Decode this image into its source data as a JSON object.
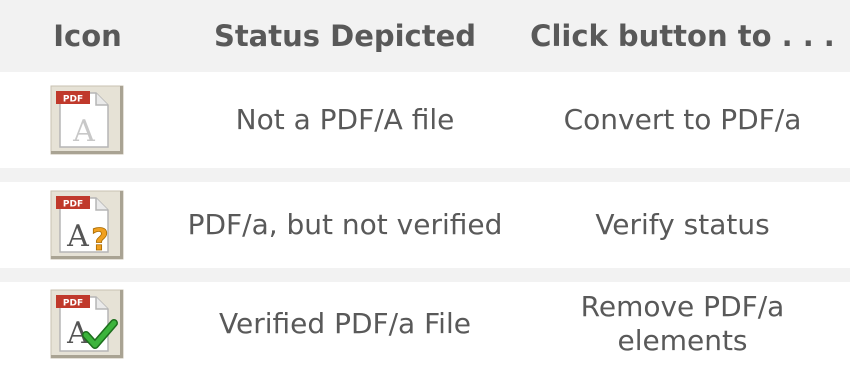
{
  "header": {
    "col_icon": "Icon",
    "col_status": "Status Depicted",
    "col_action": "Click button to . . ."
  },
  "rows": [
    {
      "icon": "pdf-a-not-pdfa-icon",
      "status": "Not a PDF/A file",
      "action": "Convert to PDF/a"
    },
    {
      "icon": "pdf-a-unverified-icon",
      "status": "PDF/a, but not verified",
      "action": "Verify status"
    },
    {
      "icon": "pdf-a-verified-icon",
      "status": "Verified PDF/a File",
      "action": "Remove PDF/a elements"
    }
  ],
  "icon_text": {
    "badge": "PDF",
    "letter": "A",
    "question": "?"
  },
  "colors": {
    "header_bg": "#f2f2f2",
    "text": "#595959",
    "badge_red": "#c0392b",
    "question_orange": "#f0a020",
    "check_green": "#2e9e2e"
  }
}
